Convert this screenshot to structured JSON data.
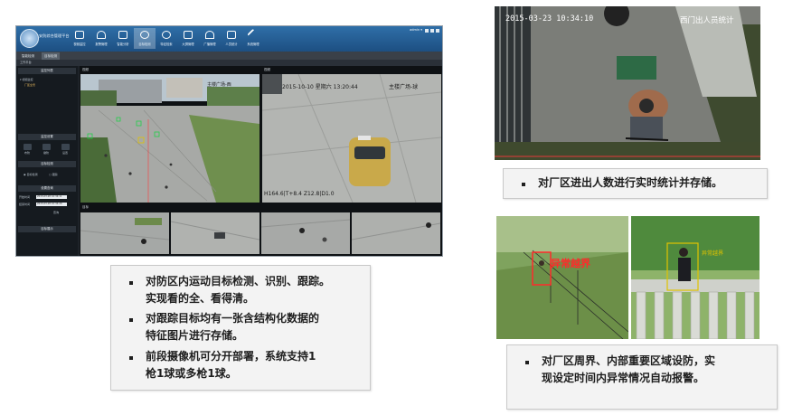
{
  "app": {
    "title": "安防综合管理平台",
    "nav": [
      {
        "label": "视频监控",
        "icon": "camera-icon"
      },
      {
        "label": "报警管理",
        "icon": "bell-icon"
      },
      {
        "label": "智能分析",
        "icon": "chart-icon"
      },
      {
        "label": "目标检测",
        "icon": "target-icon"
      },
      {
        "label": "特征检索",
        "icon": "search-icon"
      },
      {
        "label": "大屏管理",
        "icon": "monitor-icon"
      },
      {
        "label": "广播管理",
        "icon": "broadcast-icon"
      },
      {
        "label": "人员统计",
        "icon": "truck-icon"
      },
      {
        "label": "系统管理",
        "icon": "tools-icon"
      }
    ],
    "user": "admin ▾",
    "tabs": [
      "智能检测",
      "目标检测"
    ],
    "breadcrumb": "工作平台",
    "panels": {
      "monitor_list": "监控列表",
      "tree_root": "▾ 视频监控",
      "tree_child": "厂区全景",
      "monitor_settings": "监控设置",
      "buttons": [
        "布防",
        "撤防",
        "设置"
      ],
      "target_detection": "目标检测",
      "radio_options": [
        "目标检测",
        "跟踪"
      ],
      "settings_query": "设置查询",
      "start_label": "开始时间",
      "end_label": "结束时间",
      "start_value": "2015-03-28 10:34:11",
      "end_value": "2015-03-28 10:34:20",
      "query_button": "查询",
      "target_display": "目标展示"
    },
    "video": {
      "main_label": "视频",
      "cam1_label": "主楼广场-西",
      "cam2_label": "主楼广场-球",
      "cam2_time": "2015-10-10 星期六 13:20:44",
      "cam2_meta": "H164.6|T+8.4  Z12.8|D1.0",
      "thumbs_label": "目标"
    }
  },
  "bullets": {
    "box1": [
      "对防区内运动目标检测、识别、跟踪。",
      "实现看的全、看得清。",
      "对跟踪目标均有一张含结构化数据的",
      "特征图片进行存储。",
      "前段摄像机可分开部署，系统支持1",
      "枪1球或多枪1球。"
    ],
    "box2": [
      "对厂区进出人数进行实时统计并存储。"
    ],
    "box3": [
      "对厂区周界、内部重要区域设防，实",
      "现设定时间内异常情况自动报警。"
    ]
  },
  "photos": {
    "counting": {
      "timestamp": "2015-03-23 10:34:10",
      "label": "西门出人员统计"
    },
    "perimeter": {
      "alarm_label": "异常越界"
    }
  },
  "colors": {
    "app_header": "#1d4f82",
    "detect_box": "#ff2a2a",
    "track_box": "#e0c200",
    "track_dot": "#22d04a"
  }
}
